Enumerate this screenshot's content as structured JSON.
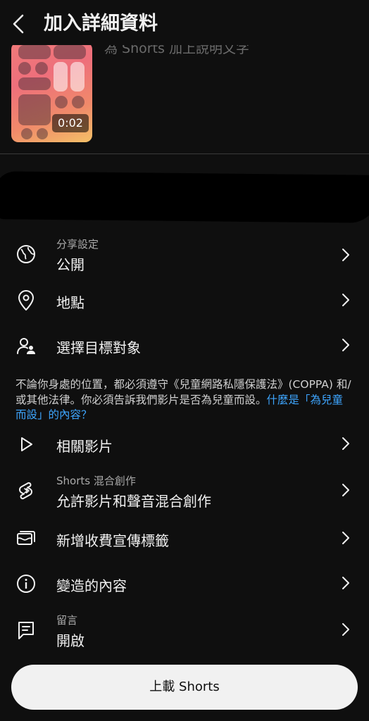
{
  "header": {
    "title": "加入詳細資料"
  },
  "video": {
    "duration": "0:02",
    "caption_placeholder": "為 Shorts 加上說明文字"
  },
  "settings": {
    "visibility": {
      "label": "分享設定",
      "value": "公開"
    },
    "location": {
      "label": "地點"
    },
    "audience": {
      "label": "選擇目標對象"
    },
    "notice": {
      "text": "不論你身處的位置，都必須遵守《兒童網路私隱保護法》(COPPA) 和/或其他法律。你必須告訴我們影片是否為兒童而設。",
      "link": "什麼是「為兒童而設」的內容？"
    },
    "related": {
      "label": "相關影片"
    },
    "remix": {
      "label": "Shorts 混合創作",
      "value": "允許影片和聲音混合創作"
    },
    "paid_promo": {
      "label": "新增收費宣傳標籤"
    },
    "altered": {
      "label": "變造的內容"
    },
    "comments": {
      "label": "留言",
      "value": "開啟"
    }
  },
  "actions": {
    "upload_label": "上載 Shorts"
  },
  "colors": {
    "background": "#0f0f0f",
    "link": "#3ea6ff",
    "button_bg": "#f1f1f1"
  }
}
